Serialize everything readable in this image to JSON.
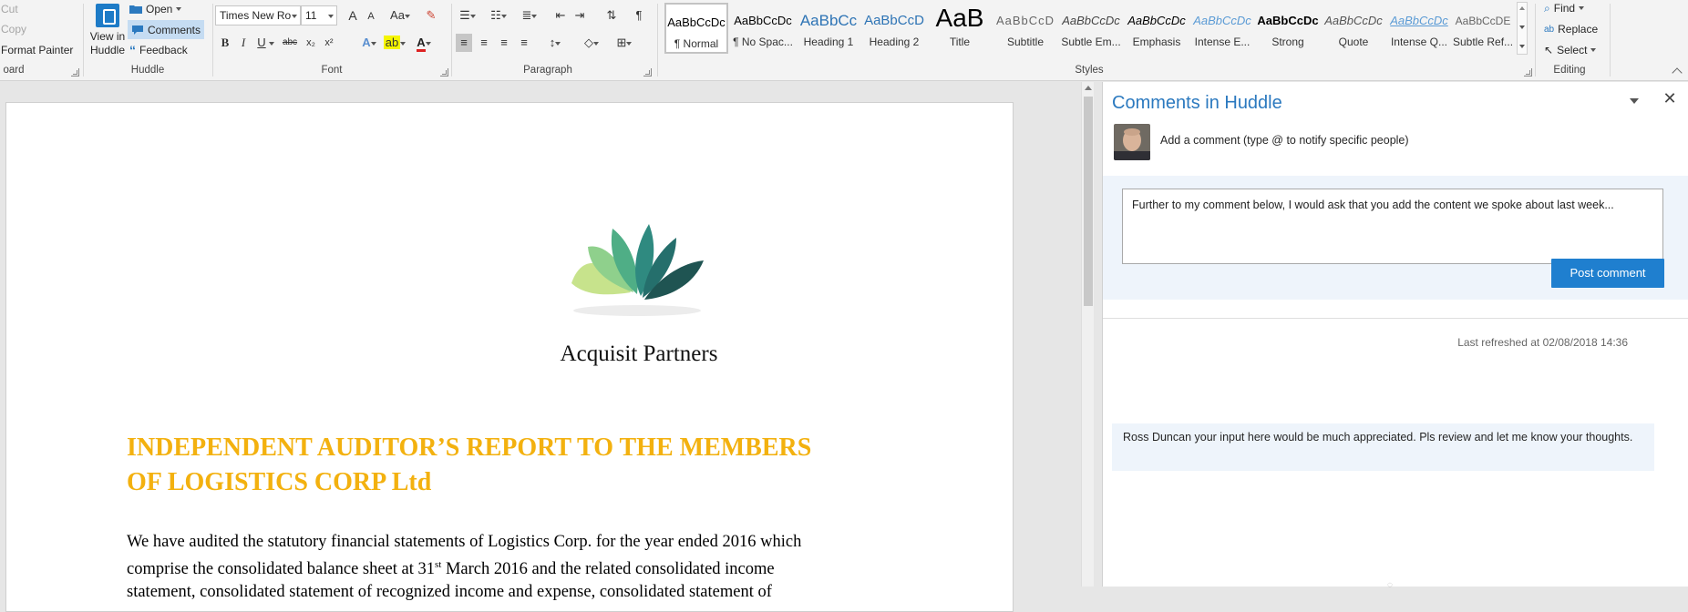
{
  "ribbon": {
    "clipboard": {
      "cut_label": "Cut",
      "copy_label": "Copy",
      "format_painter_label": "Format Painter",
      "group_label": "oard"
    },
    "huddle": {
      "view_line1": "View in",
      "view_line2": "Huddle",
      "open_label": "Open",
      "comments_label": "Comments",
      "feedback_label": "Feedback",
      "group_label": "Huddle"
    },
    "font": {
      "font_name": "Times New Ro",
      "font_size": "11",
      "group_label": "Font",
      "change_case": "Aa",
      "bold": "B",
      "italic": "I",
      "underline": "U",
      "strike": "abc",
      "subscript": "x₂",
      "superscript": "x²",
      "text_effects": "A",
      "font_color": "A",
      "grow": "A",
      "shrink": "A"
    },
    "paragraph": {
      "group_label": "Paragraph",
      "show_marks": "¶"
    },
    "styles": {
      "group_label": "Styles",
      "items": [
        {
          "sample": "AaBbCcDc",
          "name": "¶ Normal"
        },
        {
          "sample": "AaBbCcDc",
          "name": "¶ No Spac..."
        },
        {
          "sample": "AaBbCc",
          "name": "Heading 1"
        },
        {
          "sample": "AaBbCcD",
          "name": "Heading 2"
        },
        {
          "sample": "AaB",
          "name": "Title"
        },
        {
          "sample": "AaBbCcD",
          "name": "Subtitle"
        },
        {
          "sample": "AaBbCcDc",
          "name": "Subtle Em..."
        },
        {
          "sample": "AaBbCcDc",
          "name": "Emphasis"
        },
        {
          "sample": "AaBbCcDc",
          "name": "Intense E..."
        },
        {
          "sample": "AaBbCcDc",
          "name": "Strong"
        },
        {
          "sample": "AaBbCcDc",
          "name": "Quote"
        },
        {
          "sample": "AaBbCcDc",
          "name": "Intense Q..."
        },
        {
          "sample": "AaBbCcDE",
          "name": "Subtle Ref..."
        }
      ]
    },
    "editing": {
      "group_label": "Editing",
      "find_label": "Find",
      "replace_label": "Replace",
      "select_label": "Select"
    }
  },
  "document": {
    "company_name": "Acquisit Partners",
    "heading_line1": "INDEPENDENT AUDITOR’S REPORT TO THE MEMBERS",
    "heading_line2": "OF LOGISTICS CORP Ltd",
    "body_line1": "We have audited the statutory financial statements of Logistics Corp. for the year ended 2016 which",
    "body_line2_a": "comprise the consolidated balance sheet at 31",
    "body_line2_sup": "st",
    "body_line2_b": " March 2016 and the related consolidated income",
    "body_line3": "statement, consolidated statement of recognized income and expense, consolidated statement of",
    "colors": {
      "heading": "#f3b10f"
    }
  },
  "comments_pane": {
    "title": "Comments in Huddle",
    "add_prompt": "Add a comment (type @ to notify specific people)",
    "draft_text": "Further to my comment below, I would ask that you add the content we spoke about last week...",
    "post_button": "Post comment",
    "last_refreshed": "Last refreshed at 02/08/2018 14:36",
    "comments": [
      {
        "text": "Ross Duncan your input here would be much appreciated. Pls review and let me know your thoughts."
      }
    ],
    "colors": {
      "title": "#2b79bf",
      "button": "#1f7fcf",
      "compose_bg": "#eef4fb"
    }
  }
}
